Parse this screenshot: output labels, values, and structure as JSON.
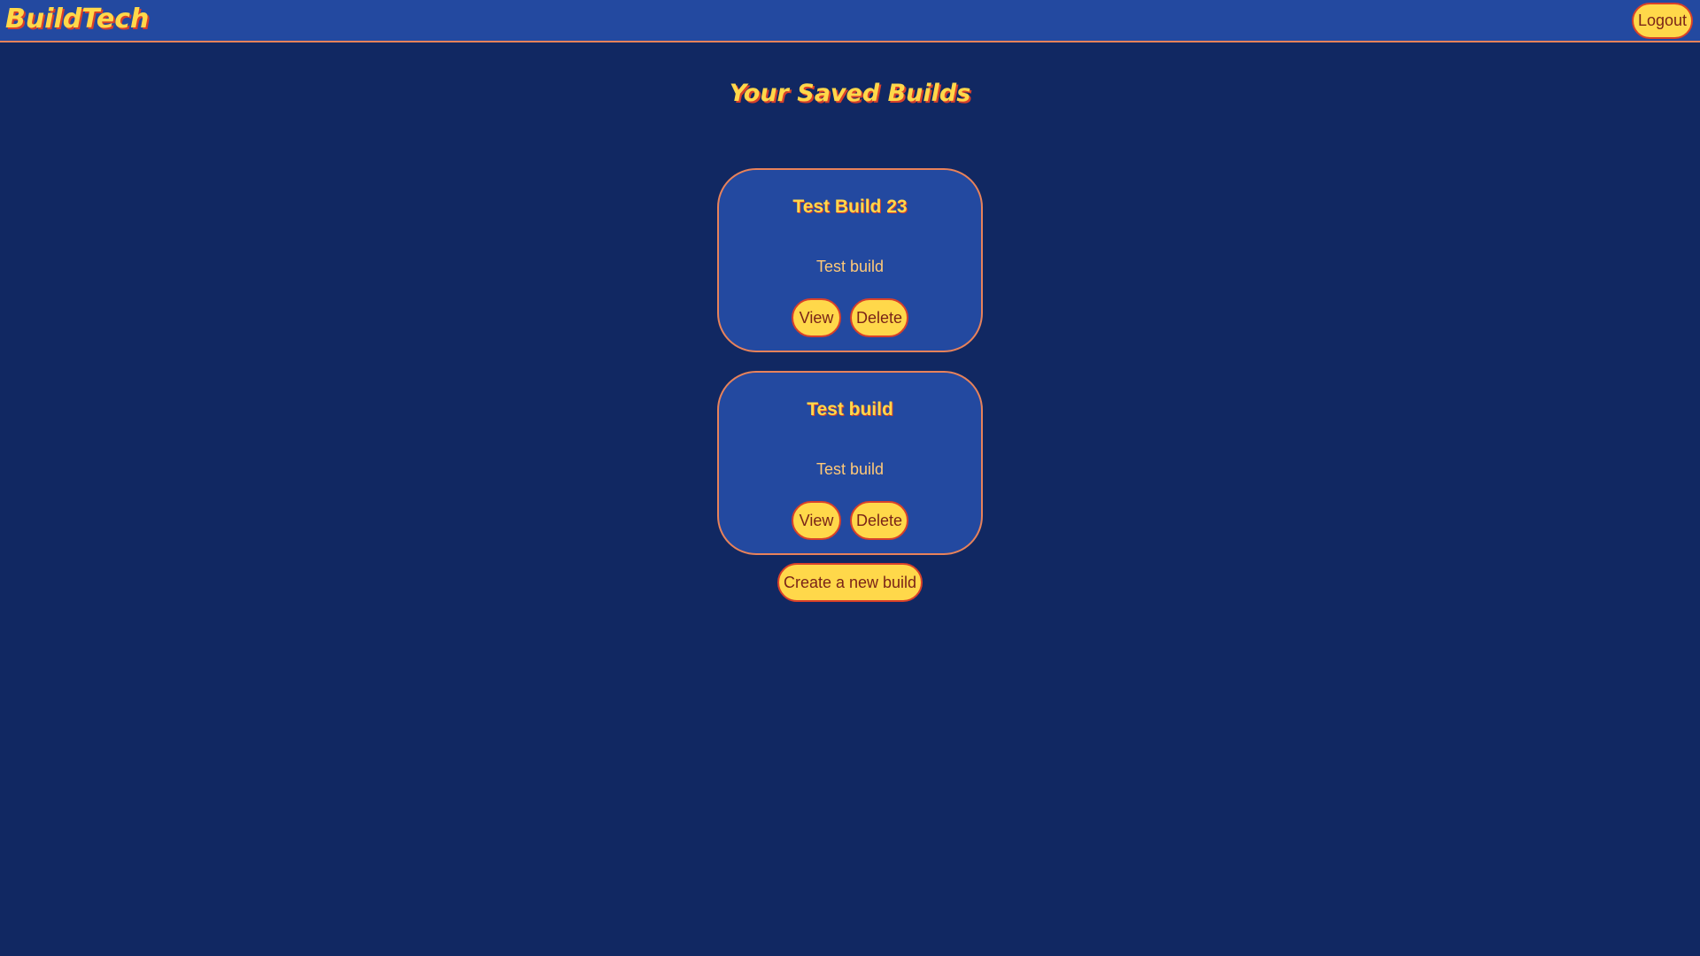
{
  "header": {
    "brand": "BuildTech",
    "logout_label": "Logout"
  },
  "main": {
    "title": "Your Saved Builds",
    "builds": [
      {
        "name": "Test Build 23",
        "description": "Test build",
        "view_label": "View",
        "delete_label": "Delete"
      },
      {
        "name": "Test build",
        "description": "Test build",
        "view_label": "View",
        "delete_label": "Delete"
      }
    ],
    "create_label": "Create a new build"
  },
  "colors": {
    "background": "#112862",
    "header": "#2349a0",
    "accent_yellow": "#ffd84a",
    "accent_red": "#d8402a",
    "border_orange": "#e8825a"
  }
}
